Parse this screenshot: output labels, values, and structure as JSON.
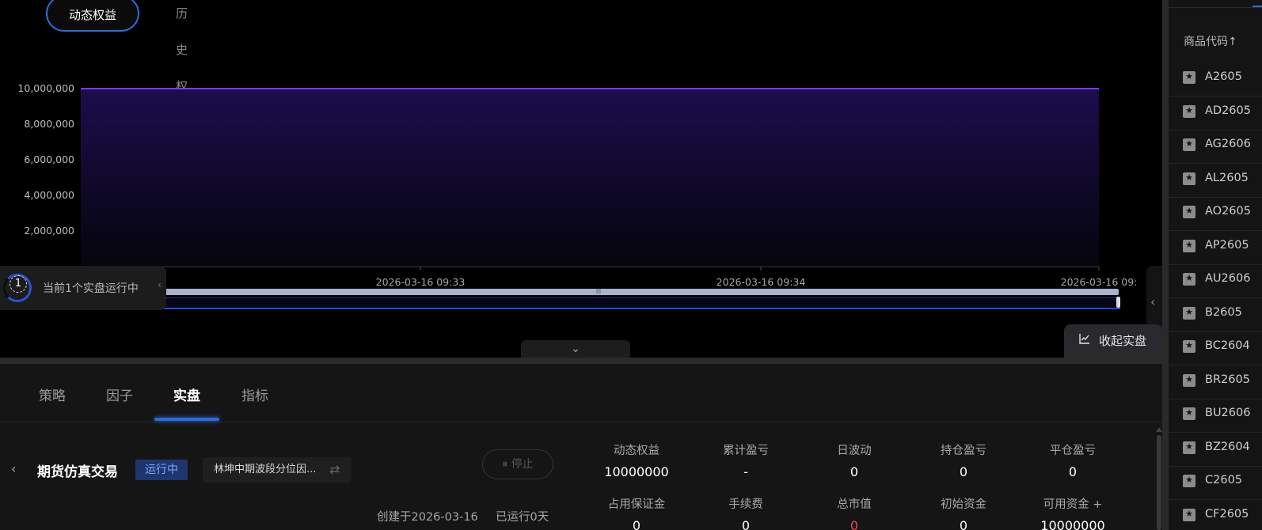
{
  "equity_tabs": {
    "active": "动态权益",
    "inactive": "历史权益"
  },
  "chart_data": {
    "type": "area",
    "y_ticks": [
      "10,000,000",
      "8,000,000",
      "6,000,000",
      "4,000,000",
      "2,000,000"
    ],
    "x_ticks": [
      "2026-03-16 09:33",
      "2026-03-16 09:34",
      "2026-03-16 09:"
    ],
    "ylim": [
      0,
      10000000
    ],
    "series": [
      {
        "values": [
          10000000,
          10000000,
          10000000
        ]
      }
    ],
    "grid": true,
    "colors": {
      "line": "#7b3fd6",
      "fill_top": "#1c0d4d",
      "fill_bottom": "#05050c"
    }
  },
  "running_notice": {
    "count": "1",
    "text": "当前1个实盘运行中"
  },
  "collapse_button": {
    "icon": "line-chart-icon",
    "label": "收起实盘"
  },
  "bottom_tabs": [
    "策略",
    "因子",
    "实盘",
    "指标"
  ],
  "active_bottom_tab": "实盘",
  "trade": {
    "title": "期货仿真交易",
    "status": "运行中",
    "strategy": "林坤中期波段分位因...",
    "stop_label": "停止",
    "created": "创建于2026-03-16",
    "running_days": "已运行0天"
  },
  "metrics": [
    {
      "label": "动态权益",
      "value": "10000000"
    },
    {
      "label": "累计盈亏",
      "value": "-"
    },
    {
      "label": "日波动",
      "value": "0"
    },
    {
      "label": "持仓盈亏",
      "value": "0"
    },
    {
      "label": "平仓盈亏",
      "value": "0"
    },
    {
      "label": "占用保证金",
      "value": "0"
    },
    {
      "label": "手续费",
      "value": "0"
    },
    {
      "label": "总市值",
      "value": "0"
    },
    {
      "label": "初始资金",
      "value": "0"
    },
    {
      "label": "可用资金 +",
      "value": "10000000"
    }
  ],
  "colors": {
    "accent": "#2e6bd8",
    "status_bg": "#1f3570",
    "negative": "#e8474a"
  },
  "sidebar": {
    "header": "商品代码↑",
    "items": [
      "A2605",
      "AD2605",
      "AG2606",
      "AL2605",
      "AO2605",
      "AP2605",
      "AU2606",
      "B2605",
      "BC2604",
      "BR2605",
      "BU2606",
      "BZ2604",
      "C2605",
      "CF2605"
    ]
  }
}
